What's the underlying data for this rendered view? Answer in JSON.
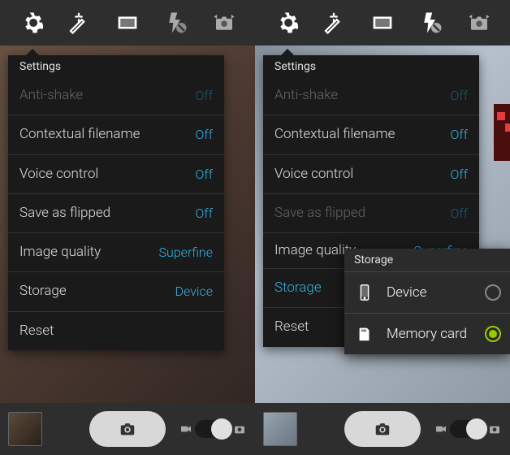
{
  "toolbar_icons": [
    "gear-icon",
    "wand-icon",
    "rectangle-icon",
    "flash-off-icon",
    "switch-camera-icon"
  ],
  "settings": {
    "header": "Settings",
    "items": [
      {
        "label": "Anti-shake",
        "value": "Off",
        "dimmed": true
      },
      {
        "label": "Contextual filename",
        "value": "Off"
      },
      {
        "label": "Voice control",
        "value": "Off"
      },
      {
        "label": "Save as flipped",
        "value": "Off"
      },
      {
        "label": "Image quality",
        "value": "Superfine"
      },
      {
        "label": "Storage",
        "value": "Device"
      },
      {
        "label": "Reset",
        "value": ""
      }
    ]
  },
  "settings_right": {
    "header": "Settings",
    "items": [
      {
        "label": "Anti-shake",
        "value": "Off",
        "dimmed": true
      },
      {
        "label": "Contextual filename",
        "value": "Off"
      },
      {
        "label": "Voice control",
        "value": "Off"
      },
      {
        "label": "Save as flipped",
        "value": "Off",
        "dimmed": true
      },
      {
        "label": "Image quality",
        "value": "Superfine",
        "clipped": true
      },
      {
        "label": "Storage",
        "value": "",
        "highlighted": true
      },
      {
        "label": "Reset",
        "value": ""
      }
    ]
  },
  "storage_popup": {
    "header": "Storage",
    "options": [
      {
        "label": "Device",
        "icon": "phone-icon",
        "selected": false
      },
      {
        "label": "Memory card",
        "icon": "sd-card-icon",
        "selected": true
      }
    ]
  }
}
